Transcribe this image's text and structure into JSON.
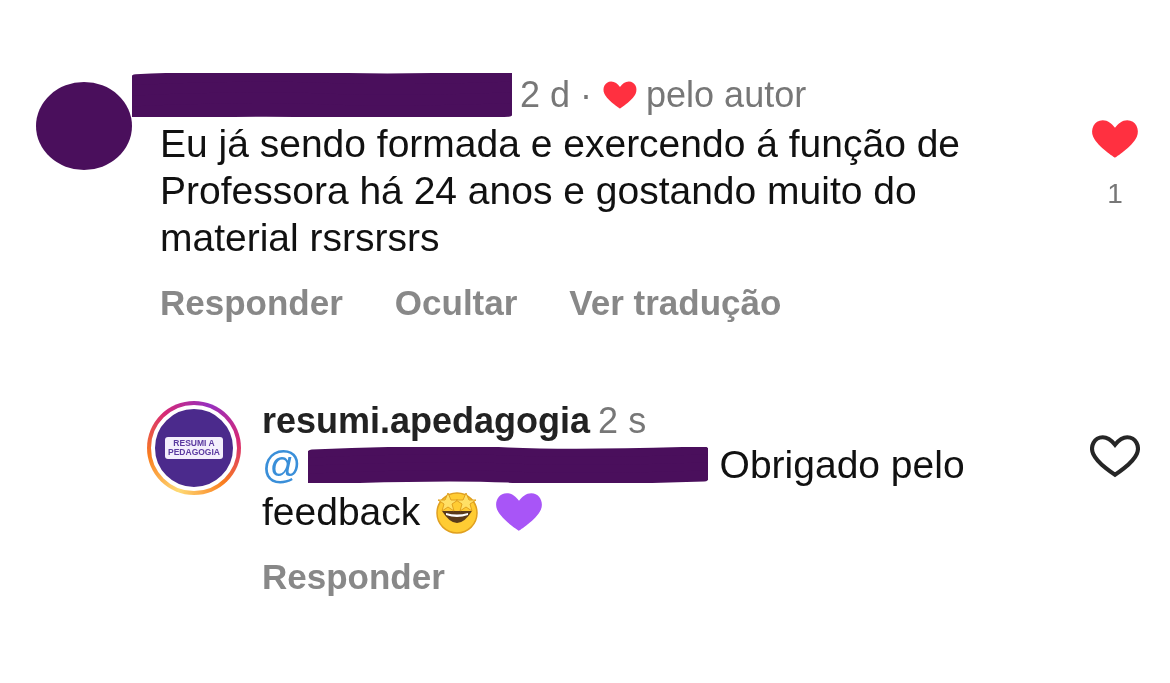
{
  "comment": {
    "author_redacted": true,
    "time": "2 d",
    "separator": "·",
    "liked_by_author": true,
    "liked_by_author_label": "pelo autor",
    "text": "Eu já sendo formada e exercendo á função de Professora há 24 anos e gostando muito do material rsrsrsrs",
    "liked": true,
    "like_count": "1",
    "actions": [
      {
        "label": "Responder"
      },
      {
        "label": "Ocultar"
      },
      {
        "label": "Ver tradução"
      }
    ]
  },
  "reply": {
    "avatar_lines": [
      "RESUMI A",
      "PEDAGOGIA"
    ],
    "story_ring": true,
    "username": "resumi.apedagogia",
    "time": "2 s",
    "mention": "@",
    "mention_redacted": true,
    "text_lines": [
      "Obrigado pelo",
      "feedback"
    ],
    "liked": false,
    "actions": [
      {
        "label": "Responder"
      }
    ]
  }
}
